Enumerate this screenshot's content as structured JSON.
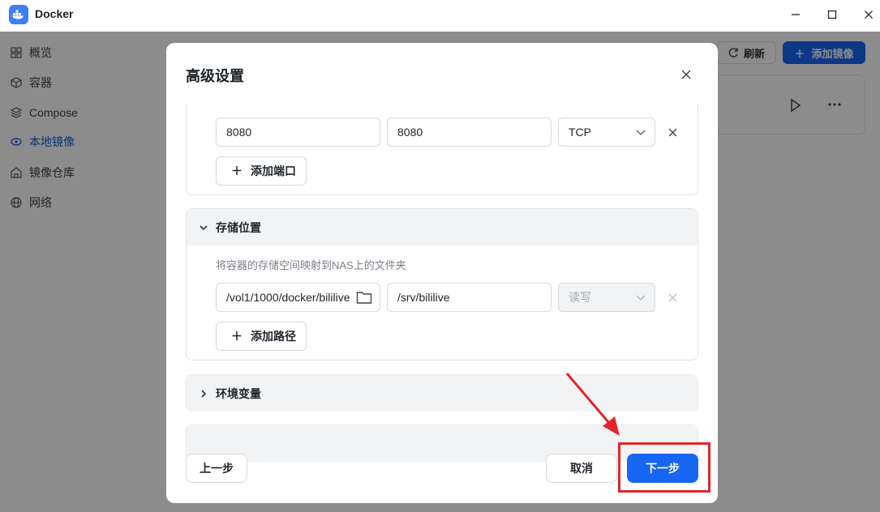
{
  "window": {
    "title": "Docker",
    "controls": [
      "minimize",
      "maximize",
      "close"
    ]
  },
  "sidebar": {
    "items": [
      {
        "label": "概览",
        "icon": "grid-icon",
        "active": false
      },
      {
        "label": "容器",
        "icon": "cube-icon",
        "active": false
      },
      {
        "label": "Compose",
        "icon": "layers-icon",
        "active": false
      },
      {
        "label": "本地镜像",
        "icon": "disc-icon",
        "active": true
      },
      {
        "label": "镜像仓库",
        "icon": "home-icon",
        "active": false
      },
      {
        "label": "网络",
        "icon": "globe-icon",
        "active": false
      }
    ]
  },
  "toolbar": {
    "refresh_label": "刷新",
    "add_image_label": "添加镜像"
  },
  "dialog": {
    "title": "高级设置",
    "ports": {
      "row": {
        "host_port": "8080",
        "container_port": "8080",
        "protocol": "TCP"
      },
      "add_label": "添加端口"
    },
    "storage": {
      "title": "存储位置",
      "hint": "将容器的存储空间映射到NAS上的文件夹",
      "row": {
        "host_path": "/vol1/1000/docker/bililive",
        "container_path": "/srv/bililive",
        "mode": "读写"
      },
      "add_label": "添加路径"
    },
    "env": {
      "title": "环境变量"
    },
    "footer": {
      "prev_label": "上一步",
      "cancel_label": "取消",
      "next_label": "下一步"
    }
  },
  "colors": {
    "accent": "#1766f2",
    "annotation": "#e0262b"
  }
}
